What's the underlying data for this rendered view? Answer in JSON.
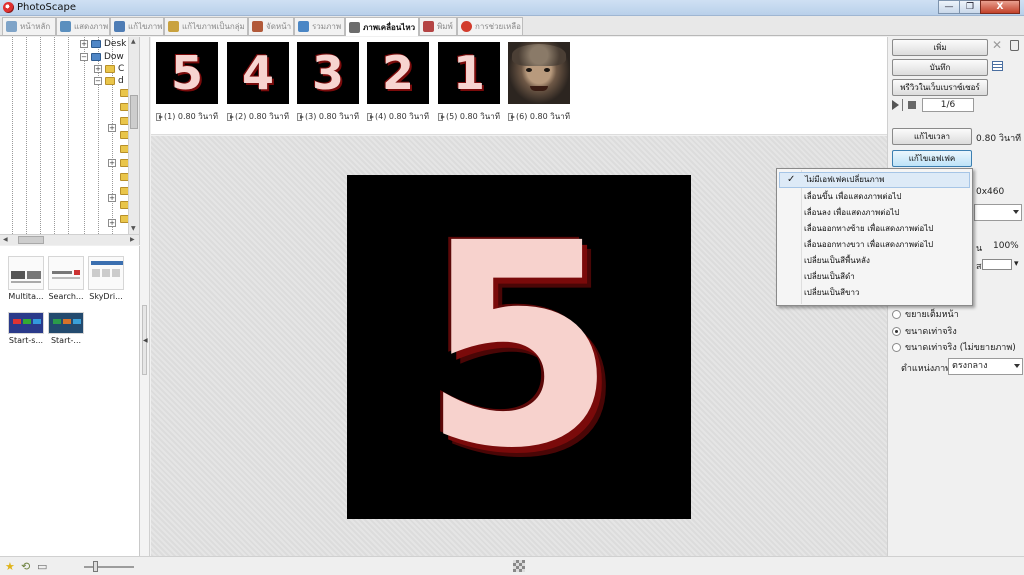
{
  "window": {
    "title": "PhotoScape",
    "buttons": {
      "minimize": "—",
      "maximize": "❐",
      "close": "X"
    }
  },
  "tabs": [
    {
      "label": "หน้าหลัก",
      "color": "#7fa4c8",
      "active": false
    },
    {
      "label": "แสดงภาพ",
      "color": "#5b8fbe",
      "active": false
    },
    {
      "label": "แก้ไขภาพ",
      "color": "#4f7db5",
      "active": false
    },
    {
      "label": "แก้ไขภาพเป็นกลุ่ม",
      "color": "#c9a23f",
      "active": false
    },
    {
      "label": "จัดหน้า",
      "color": "#b25a3a",
      "active": false
    },
    {
      "label": "รวมภาพ",
      "color": "#4a86c5",
      "active": false
    },
    {
      "label": "ภาพเคลื่อนไหว",
      "color": "#6c6c6c",
      "active": true
    },
    {
      "label": "พิมพ์",
      "color": "#b44444",
      "active": false
    },
    {
      "label": "การช่วยเหลือ",
      "color": "#d23c2c",
      "active": false
    }
  ],
  "tree": {
    "items": [
      {
        "label": "Desk",
        "expander": "+"
      },
      {
        "label": "Dow",
        "expander": "−"
      },
      {
        "label": "C",
        "expander": "+"
      },
      {
        "label": "d",
        "expander": "−"
      }
    ]
  },
  "files": [
    {
      "label": "Multita..."
    },
    {
      "label": "Search..."
    },
    {
      "label": "SkyDri..."
    },
    {
      "label": "Start-s..."
    },
    {
      "label": "Start-..."
    }
  ],
  "frames": [
    {
      "digit": "5",
      "label": "(1) 0.80 วินาที"
    },
    {
      "digit": "4",
      "label": "(2) 0.80 วินาที"
    },
    {
      "digit": "3",
      "label": "(3) 0.80 วินาที"
    },
    {
      "digit": "2",
      "label": "(4) 0.80 วินาที"
    },
    {
      "digit": "1",
      "label": "(5) 0.80 วินาที"
    },
    {
      "digit": "",
      "label": "(6) 0.80 วินาที"
    }
  ],
  "preview": {
    "digit": "5"
  },
  "right_panel": {
    "add_button": "เพิ่ม",
    "save_button": "บันทึก",
    "preview_browser_button": "พรีวิวในเว็บเบราซ์เซอร์",
    "counter": "1/6",
    "edit_time_button": "แก้ไขเวลา",
    "time_value": "0.80 วินาที",
    "edit_effect_button": "แก้ไขเอฟเฟค",
    "size_value": "0x460",
    "percent_value": "100%",
    "fit_option": "ขยายเต็มหน้า",
    "actual_size_option": "ขนาดเท่าจริง",
    "actual_no_enlarge_option": "ขนาดเท่าจริง (ไม่ขยายภาพ)",
    "position_label": "ตำแหน่งภาพ",
    "position_value": "ตรงกลาง"
  },
  "effect_menu": {
    "items": [
      {
        "label": "ไม่มีเอฟเฟคเปลี่ยนภาพ",
        "checked": true
      },
      {
        "label": "เลื่อนขึ้น เพื่อแสดงภาพต่อไป",
        "checked": false
      },
      {
        "label": "เลื่อนลง เพื่อแสดงภาพต่อไป",
        "checked": false
      },
      {
        "label": "เลื่อนออกทางซ้าย เพื่อแสดงภาพต่อไป",
        "checked": false
      },
      {
        "label": "เลื่อนออกทางขวา เพื่อแสดงภาพต่อไป",
        "checked": false
      },
      {
        "label": "เปลี่ยนเป็นสีพื้นหลัง",
        "checked": false
      },
      {
        "label": "เปลี่ยนเป็นสีดำ",
        "checked": false
      },
      {
        "label": "เปลี่ยนเป็นสีขาว",
        "checked": false
      }
    ],
    "check_glyph": "✓"
  }
}
